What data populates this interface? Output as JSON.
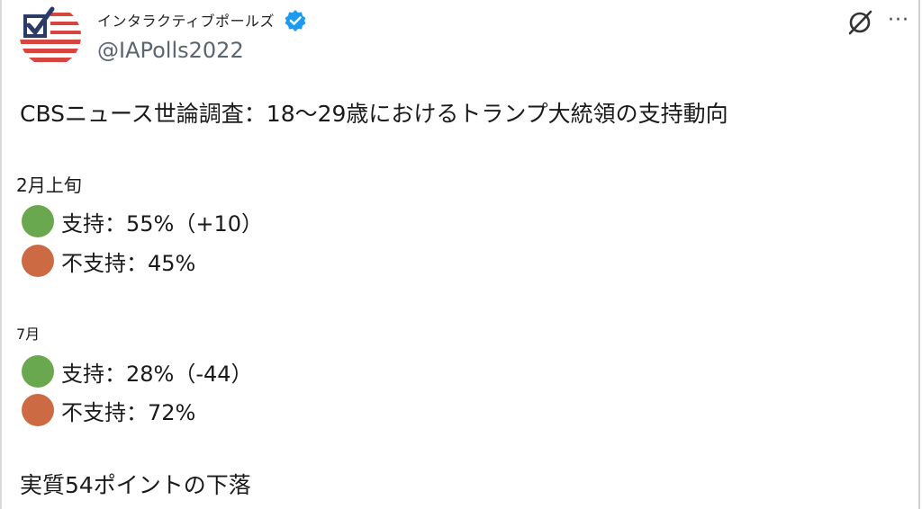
{
  "author": {
    "display_name": "インタラクティブポールズ",
    "handle": "@IAPolls2022",
    "verified": true,
    "avatar_icon": "checkmark-flag-logo-icon"
  },
  "actions": {
    "grok_icon": "slashed-circle-icon",
    "more_icon": "more-options-icon",
    "more_glyph": "···"
  },
  "post": {
    "headline": "CBSニュース世論調査：18〜29歳におけるトランプ大統領の支持動向",
    "periods": [
      {
        "label": "2月上旬",
        "rows": [
          {
            "text": "支持：55%（+10）",
            "color": "#6aa84f"
          },
          {
            "text": "不支持：45%",
            "color": "#cc6a44"
          }
        ]
      },
      {
        "label": "7月",
        "rows": [
          {
            "text": "支持：28%（-44）",
            "color": "#6aa84f"
          },
          {
            "text": "不支持：72%",
            "color": "#cc6a44"
          }
        ]
      }
    ],
    "summary": "実質54ポイントの下落"
  },
  "colors": {
    "support": "#6aa84f",
    "oppose": "#cc6a44",
    "verified_blue": "#1d9bf0",
    "logo_red": "#d6453f",
    "logo_navy": "#2b3a67"
  }
}
